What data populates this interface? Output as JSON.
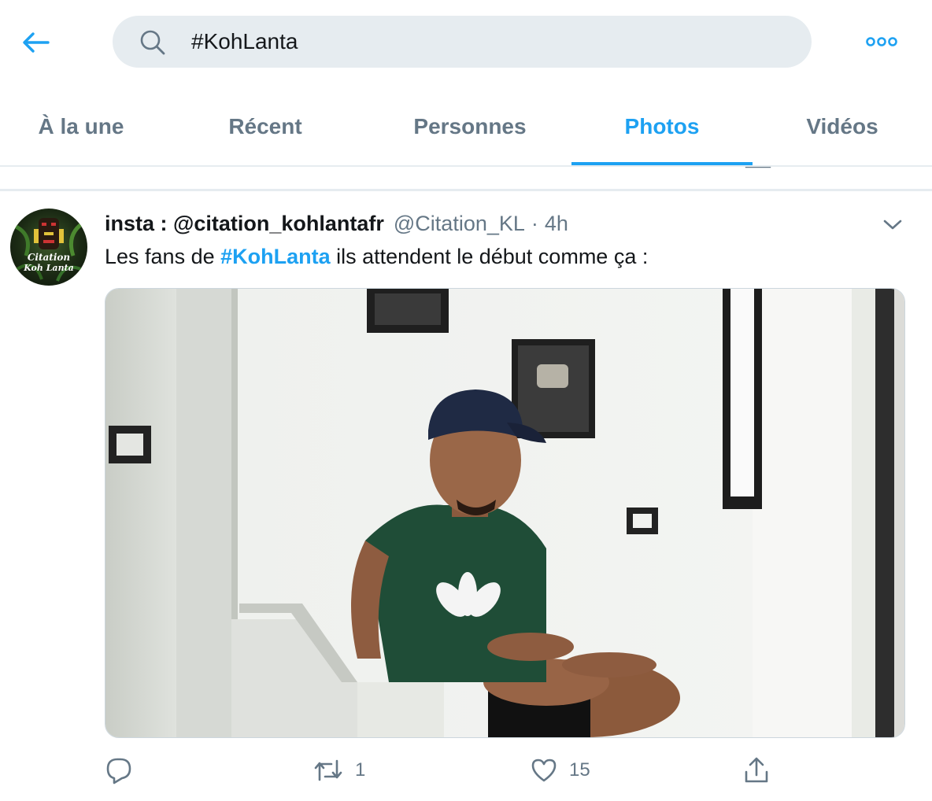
{
  "search": {
    "query": "#KohLanta"
  },
  "tabs": [
    {
      "label": "À la une",
      "active": false
    },
    {
      "label": "Récent",
      "active": false
    },
    {
      "label": "Personnes",
      "active": false
    },
    {
      "label": "Photos",
      "active": true
    },
    {
      "label": "Vidéos",
      "active": false
    }
  ],
  "icons": {
    "back": "back-arrow-icon",
    "search": "search-icon",
    "more": "more-icon",
    "caret": "chevron-down-icon",
    "reply": "reply-icon",
    "retweet": "retweet-icon",
    "like": "heart-icon",
    "share": "share-icon"
  },
  "colors": {
    "accent": "#1da1f2",
    "secondary_text": "#657786",
    "search_bg": "#e6ecf0"
  },
  "tweet": {
    "display_name": "insta : @citation_kohlantafr",
    "handle": "@Citation_KL",
    "separator": "·",
    "time": "4h",
    "avatar_text_1": "Citation",
    "avatar_text_2": "Koh Lanta",
    "text_before": "Les fans de ",
    "hashtag": "#KohLanta",
    "text_after": " ils attendent le début comme ça :",
    "replies": "",
    "retweets": "1",
    "likes": "15"
  }
}
